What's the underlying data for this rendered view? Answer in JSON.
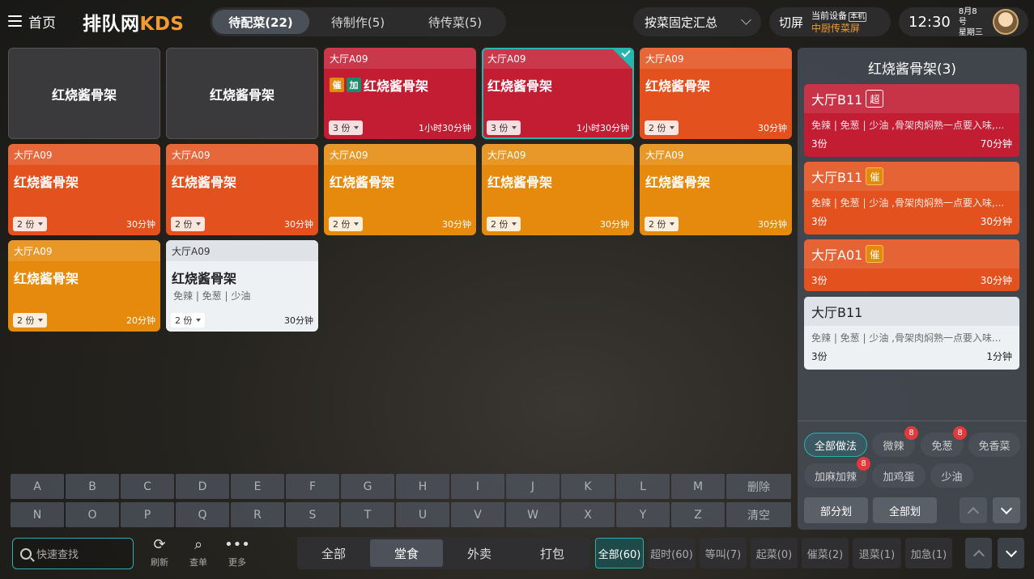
{
  "header": {
    "home_label": "首页",
    "logo_main": "排队网",
    "logo_kds": "KDS",
    "status_tabs": [
      "待配菜(22)",
      "待制作(5)",
      "待传菜(5)"
    ],
    "summary_select": "按菜固定汇总",
    "switch_screen": "切屏",
    "device_label": "当前设备",
    "device_tag": "本机",
    "device_name": "中厨传菜屏",
    "time": "12:30",
    "date": "8月8号",
    "weekday": "星期三"
  },
  "cards": [
    {
      "table": "",
      "dish": "红烧酱骨架",
      "qty": "",
      "time": "",
      "note": "",
      "tags": []
    },
    {
      "table": "",
      "dish": "红烧酱骨架",
      "qty": "",
      "time": "",
      "note": "",
      "tags": []
    },
    {
      "table": "大厅A09",
      "dish": "红烧酱骨架",
      "qty": "3 份",
      "time": "1小时30分钟",
      "note": "",
      "tags": [
        "催",
        "加"
      ]
    },
    {
      "table": "大厅A09",
      "dish": "红烧酱骨架",
      "qty": "3 份",
      "time": "1小时30分钟",
      "note": "",
      "tags": []
    },
    {
      "table": "大厅A09",
      "dish": "红烧酱骨架",
      "qty": "2 份",
      "time": "30分钟",
      "note": "",
      "tags": []
    },
    {
      "table": "大厅A09",
      "dish": "红烧酱骨架",
      "qty": "2 份",
      "time": "30分钟",
      "note": "",
      "tags": []
    },
    {
      "table": "大厅A09",
      "dish": "红烧酱骨架",
      "qty": "2 份",
      "time": "30分钟",
      "note": "",
      "tags": []
    },
    {
      "table": "大厅A09",
      "dish": "红烧酱骨架",
      "qty": "2 份",
      "time": "30分钟",
      "note": "",
      "tags": []
    },
    {
      "table": "大厅A09",
      "dish": "红烧酱骨架",
      "qty": "2 份",
      "time": "30分钟",
      "note": "",
      "tags": []
    },
    {
      "table": "大厅A09",
      "dish": "红烧酱骨架",
      "qty": "2 份",
      "time": "30分钟",
      "note": "",
      "tags": []
    },
    {
      "table": "大厅A09",
      "dish": "红烧酱骨架",
      "qty": "2 份",
      "time": "20分钟",
      "note": "",
      "tags": []
    },
    {
      "table": "大厅A09",
      "dish": "红烧酱骨架",
      "qty": "2 份",
      "time": "30分钟",
      "note": "免辣 | 免葱 | 少油",
      "tags": []
    }
  ],
  "panel": {
    "title": "红烧酱骨架(3)",
    "orders": [
      {
        "table": "大厅B11",
        "badge": "超",
        "note": "免辣 | 免葱 | 少油 ,骨架肉焖熟一点要入味,...",
        "qty": "3份",
        "time": "70分钟"
      },
      {
        "table": "大厅B11",
        "badge": "催",
        "note": "免辣 | 免葱 | 少油 ,骨架肉焖熟一点要入味,...",
        "qty": "3份",
        "time": "30分钟"
      },
      {
        "table": "大厅A01",
        "badge": "催",
        "note": "",
        "qty": "3份",
        "time": "30分钟"
      },
      {
        "table": "大厅B11",
        "badge": "",
        "note": "免辣 | 免葱 | 少油 ,骨架肉焖熟一点要入味...",
        "qty": "3份",
        "time": "1分钟"
      }
    ],
    "methods": [
      {
        "label": "全部做法",
        "count": ""
      },
      {
        "label": "微辣",
        "count": "8"
      },
      {
        "label": "免葱",
        "count": "8"
      },
      {
        "label": "免香菜",
        "count": ""
      },
      {
        "label": "加麻加辣",
        "count": "8"
      },
      {
        "label": "加鸡蛋",
        "count": ""
      },
      {
        "label": "少油",
        "count": ""
      }
    ],
    "partial_btn": "部分划",
    "all_btn": "全部划"
  },
  "keyboard": {
    "row1": [
      "A",
      "B",
      "C",
      "D",
      "E",
      "F",
      "G",
      "H",
      "I",
      "J",
      "K",
      "L",
      "M",
      "删除"
    ],
    "row2": [
      "N",
      "O",
      "P",
      "Q",
      "R",
      "S",
      "T",
      "U",
      "V",
      "W",
      "X",
      "Y",
      "Z",
      "清空"
    ]
  },
  "bottom": {
    "search_placeholder": "快速查找",
    "refresh": "刷新",
    "query": "查单",
    "more": "更多",
    "type_tabs": [
      "全部",
      "堂食",
      "外卖",
      "打包"
    ],
    "filters": [
      "全部(60)",
      "超时(60)",
      "等叫(7)",
      "起菜(0)",
      "催菜(2)",
      "退菜(1)",
      "加急(1)"
    ]
  },
  "colors": {
    "accent": "#2cb0ad",
    "brand_orange": "#f39b2d",
    "urgent_red": "#c21d33"
  }
}
